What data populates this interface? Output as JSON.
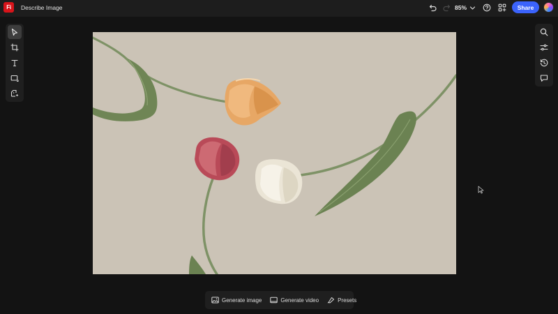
{
  "app": {
    "logo_text": "Fi",
    "document_title": "Describe Image",
    "brand_color": "#d8141a"
  },
  "topbar": {
    "undo_icon": "undo-icon",
    "redo_icon": "redo-icon",
    "zoom_level": "85%",
    "help_icon": "help-icon",
    "apps_icon": "apps-icon",
    "share_label": "Share",
    "share_color": "#3b63fb"
  },
  "left_tools": [
    {
      "name": "select-tool",
      "icon": "pointer-icon",
      "active": true
    },
    {
      "name": "crop-tool",
      "icon": "crop-icon",
      "active": false
    },
    {
      "name": "text-tool",
      "icon": "text-icon",
      "active": false
    },
    {
      "name": "shape-tool",
      "icon": "rectangle-icon",
      "active": false
    },
    {
      "name": "generate-tool",
      "icon": "image-generate-icon",
      "active": false
    }
  ],
  "right_tools": [
    {
      "name": "search-tool",
      "icon": "search-icon"
    },
    {
      "name": "adjust-tool",
      "icon": "sliders-icon"
    },
    {
      "name": "history-tool",
      "icon": "history-icon"
    },
    {
      "name": "comments-tool",
      "icon": "comment-icon"
    }
  ],
  "canvas": {
    "background_color": "#cbc3b6"
  },
  "bottom_toolbar": {
    "generate_image_label": "Generate image",
    "generate_video_label": "Generate video",
    "presets_label": "Presets"
  }
}
